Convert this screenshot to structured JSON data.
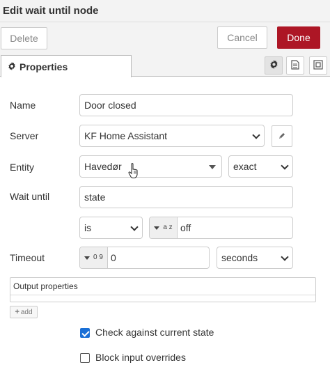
{
  "dialog": {
    "title": "Edit wait until node"
  },
  "toolbar": {
    "delete_label": "Delete",
    "cancel_label": "Cancel",
    "done_label": "Done"
  },
  "tabs": {
    "properties_label": "Properties"
  },
  "form": {
    "name": {
      "label": "Name",
      "value": "Door closed"
    },
    "server": {
      "label": "Server",
      "value": "KF Home Assistant"
    },
    "entity": {
      "label": "Entity",
      "value": "Havedør",
      "match": "exact"
    },
    "wait_until": {
      "label": "Wait until",
      "property": "state",
      "operator": "is",
      "value_type": "a z",
      "value": "off"
    },
    "timeout": {
      "label": "Timeout",
      "value_type": "0 9",
      "value": "0",
      "units": "seconds"
    },
    "output_properties": {
      "label": "Output properties",
      "add_label": "add"
    },
    "check_current": {
      "label": "Check against current state",
      "checked": true
    },
    "block_overrides": {
      "label": "Block input overrides",
      "checked": false
    }
  },
  "colors": {
    "done_bg": "#ad1625",
    "checkbox": "#1a6fd6"
  },
  "icons": [
    "gear-icon",
    "document-icon",
    "frame-icon",
    "pencil-icon",
    "plus-icon",
    "hand-cursor-icon"
  ]
}
